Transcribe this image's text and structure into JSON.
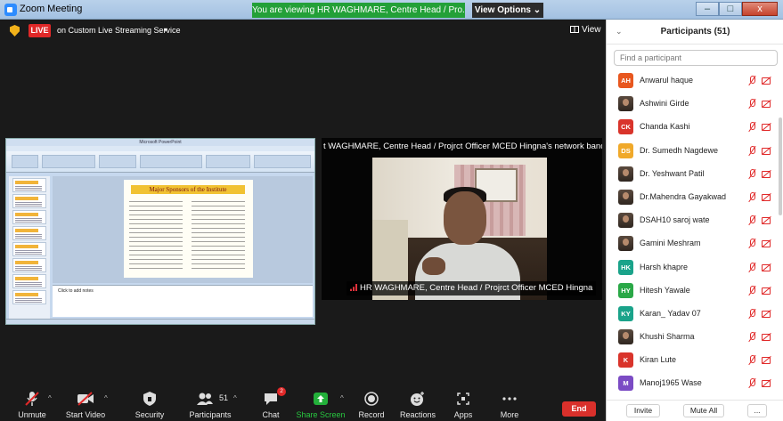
{
  "window": {
    "title": "Zoom Meeting",
    "minimize_label": "–",
    "maximize_label": "□",
    "close_label": "x"
  },
  "banner": {
    "viewing_text": "You are viewing HR WAGHMARE, Centre Head / Pro...'s screen",
    "view_options_label": "View Options ⌄"
  },
  "meeting": {
    "live_badge": "LIVE",
    "stream_text": "on Custom Live Streaming Service",
    "stream_caret": "▾",
    "view_label": "View"
  },
  "shared_screen": {
    "ppt_window_title": "Microsoft PowerPoint",
    "slide_title": "Major Sponsors of the Institute",
    "notes_placeholder": "Click to add notes"
  },
  "video": {
    "bandwidth_notice": "t WAGHMARE, Centre Head / Projrct Officer MCED Hingna's network bandwidth is lo",
    "participant_name": "HR WAGHMARE, Centre Head / Projrct Officer MCED Hingna"
  },
  "toolbar": {
    "unmute": "Unmute",
    "start_video": "Start Video",
    "security": "Security",
    "participants": "Participants",
    "participants_count": "51",
    "chat": "Chat",
    "chat_badge": "2",
    "share_screen": "Share Screen",
    "record": "Record",
    "reactions": "Reactions",
    "apps": "Apps",
    "more": "More",
    "end": "End",
    "caret": "^"
  },
  "participants_panel": {
    "title": "Participants (51)",
    "collapse_icon": "⌄",
    "search_placeholder": "Find a participant",
    "participants": [
      {
        "initials": "AH",
        "color": "#e8571f",
        "name": "Anwarul haque"
      },
      {
        "initials": "",
        "color": "#5a4a3e",
        "name": "Ashwini Girde"
      },
      {
        "initials": "CK",
        "color": "#d9342b",
        "name": "Chanda Kashi"
      },
      {
        "initials": "DS",
        "color": "#f0a92a",
        "name": "Dr. Sumedh Nagdewe"
      },
      {
        "initials": "",
        "color": "#5a4a3e",
        "name": "Dr. Yeshwant Patil"
      },
      {
        "initials": "",
        "color": "#5a4a3e",
        "name": "Dr.Mahendra Gayakwad"
      },
      {
        "initials": "",
        "color": "#5a4a3e",
        "name": "DSAH10 saroj wate"
      },
      {
        "initials": "",
        "color": "#5a4a3e",
        "name": "Gamini Meshram"
      },
      {
        "initials": "HK",
        "color": "#1aa38a",
        "name": "Harsh khapre"
      },
      {
        "initials": "HY",
        "color": "#2aa847",
        "name": "Hitesh Yawale"
      },
      {
        "initials": "KY",
        "color": "#1aa38a",
        "name": "Karan_ Yadav 07"
      },
      {
        "initials": "",
        "color": "#5a4a3e",
        "name": "Khushi Sharma"
      },
      {
        "initials": "K",
        "color": "#d9342b",
        "name": "Kiran Lute"
      },
      {
        "initials": "M",
        "color": "#7b4bc4",
        "name": "Manoj1965 Wase"
      }
    ],
    "invite_label": "Invite",
    "mute_all_label": "Mute All",
    "more_label": "..."
  }
}
